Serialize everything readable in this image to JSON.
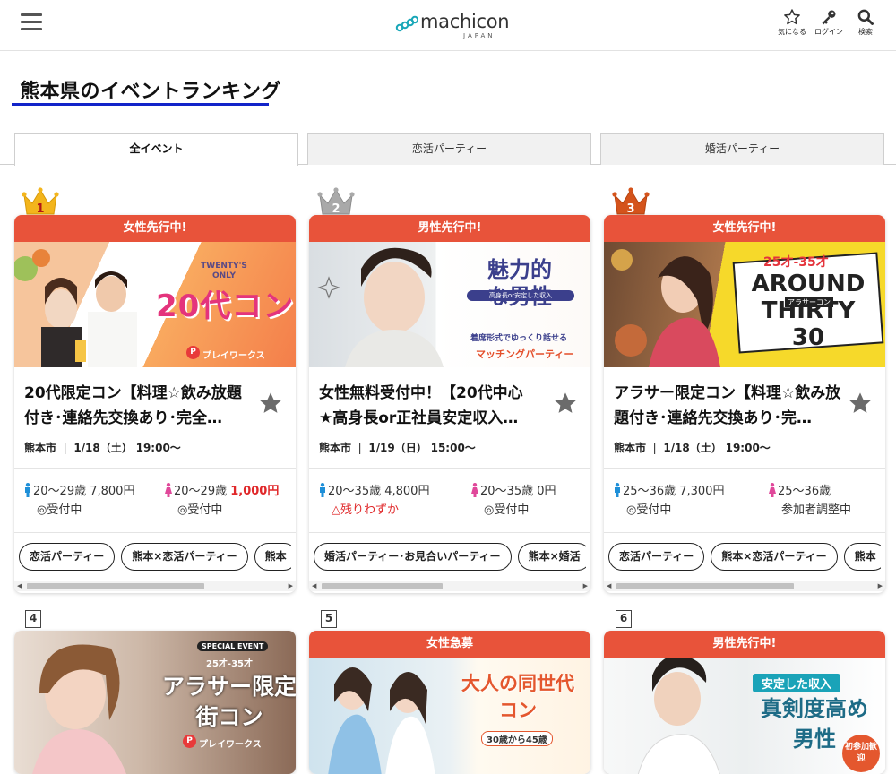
{
  "header": {
    "logo_name": "machicon",
    "logo_sub": "JAPAN",
    "favorite_label": "気になる",
    "login_label": "ログイン",
    "search_label": "検索"
  },
  "page": {
    "title": "熊本県のイベントランキング"
  },
  "tabs": [
    {
      "label": "全イベント",
      "active": true
    },
    {
      "label": "恋活パーティー",
      "active": false
    },
    {
      "label": "婚活パーティー",
      "active": false
    }
  ],
  "cards": [
    {
      "rank": "1",
      "banner": "女性先行中!",
      "photo_text": "20代コン",
      "photo_sub": "TWENTY'S ONLY",
      "photo_brand": "プレイワークス",
      "title_line1": "20代限定コン【料理☆飲み放題",
      "title_line2": "付き･連絡先交換あり･完全…",
      "city": "熊本市",
      "date": "1/18（土）",
      "time": "19:00～",
      "male_age": "20～29歳",
      "male_price": "7,800円",
      "male_status": "◎受付中",
      "female_age": "20～29歳",
      "female_price": "1,000円",
      "female_status": "◎受付中",
      "tags": [
        "恋活パーティー",
        "熊本×恋活パーティー",
        "熊本"
      ]
    },
    {
      "rank": "2",
      "banner": "男性先行中!",
      "photo_text": "魅力的な男性",
      "photo_sub": "高身長or安定した収入",
      "photo_brand": "マッチングパーティー",
      "photo_note": "着席形式でゆっくり話せる",
      "title_line1": "女性無料受付中！【20代中心",
      "title_line2": "★高身長or正社員安定収入…",
      "city": "熊本市",
      "date": "1/19（日）",
      "time": "15:00～",
      "male_age": "20～35歳",
      "male_price": "4,800円",
      "male_status": "△残りわずか",
      "female_age": "20～35歳",
      "female_price": "0円",
      "female_status": "◎受付中",
      "tags": [
        "婚活パーティー･お見合いパーティー",
        "熊本×婚活"
      ]
    },
    {
      "rank": "3",
      "banner": "女性先行中!",
      "photo_text": "AROUND THIRTY 30",
      "photo_sub": "25才-35才",
      "photo_brand": "アラサーコン",
      "title_line1": "アラサー限定コン【料理☆飲み放",
      "title_line2": "題付き･連絡先交換あり･完…",
      "city": "熊本市",
      "date": "1/18（土）",
      "time": "19:00～",
      "male_age": "25～36歳",
      "male_price": "7,300円",
      "male_status": "◎受付中",
      "female_age": "25～36歳",
      "female_price": "",
      "female_status": "参加者調整中",
      "tags": [
        "恋活パーティー",
        "熊本×恋活パーティー",
        "熊本"
      ]
    },
    {
      "rank": "4",
      "banner": "",
      "photo_text": "アラサー限定 街コン",
      "photo_sub": "SPECIAL EVENT",
      "photo_age": "25才-35才",
      "photo_brand": "プレイワークス"
    },
    {
      "rank": "5",
      "banner": "女性急募",
      "photo_text": "大人の同世代コン",
      "photo_sub": "30歳から45歳"
    },
    {
      "rank": "6",
      "banner": "男性先行中!",
      "photo_text": "真剣度高め 男性",
      "photo_sub": "安定した収入",
      "photo_badge": "初参加歓迎"
    }
  ],
  "colors": {
    "accent": "#e8533a",
    "title_underline": "#1223c9",
    "price_red": "#e0282a",
    "male_icon": "#1e8fd8",
    "female_icon": "#e0489a"
  }
}
